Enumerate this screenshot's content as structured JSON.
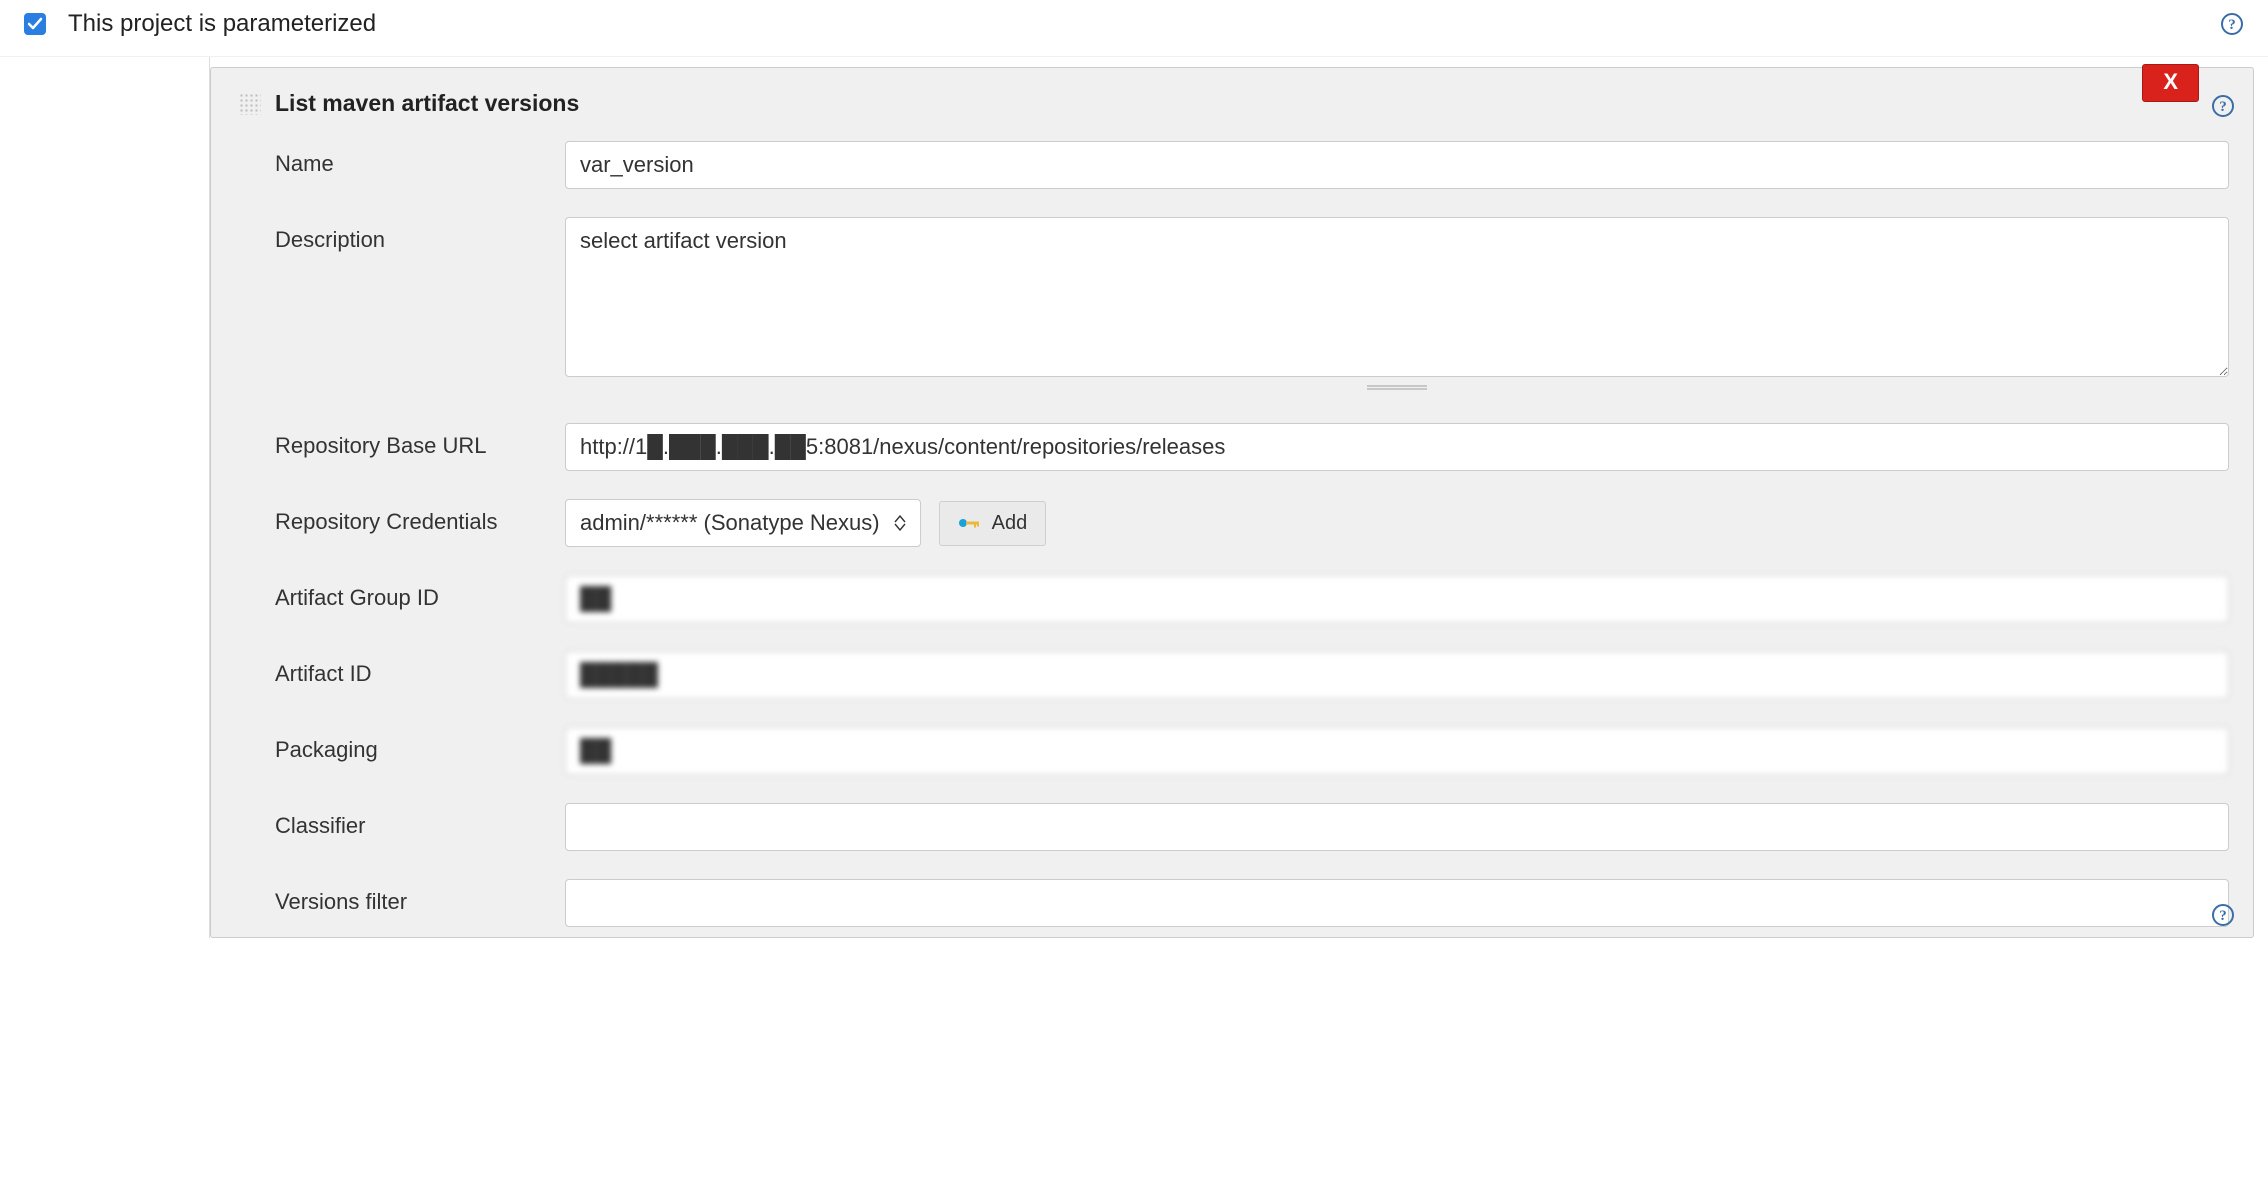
{
  "top": {
    "checkbox_checked": true,
    "label": "This project is parameterized"
  },
  "panel": {
    "title": "List maven artifact versions",
    "delete_label": "X",
    "add_button_label": "Add"
  },
  "fields": {
    "name": {
      "label": "Name",
      "value": "var_version"
    },
    "description": {
      "label": "Description",
      "value": "select artifact version"
    },
    "repo_base_url": {
      "label": "Repository Base URL",
      "value": "http://1█.███.███.██5:8081/nexus/content/repositories/releases"
    },
    "repo_credentials": {
      "label": "Repository Credentials",
      "selected": "admin/****** (Sonatype Nexus)"
    },
    "artifact_group_id": {
      "label": "Artifact Group ID",
      "value": "██"
    },
    "artifact_id": {
      "label": "Artifact ID",
      "value": "█████"
    },
    "packaging": {
      "label": "Packaging",
      "value": "██"
    },
    "classifier": {
      "label": "Classifier",
      "value": ""
    },
    "versions_filter": {
      "label": "Versions filter",
      "value": ""
    }
  }
}
